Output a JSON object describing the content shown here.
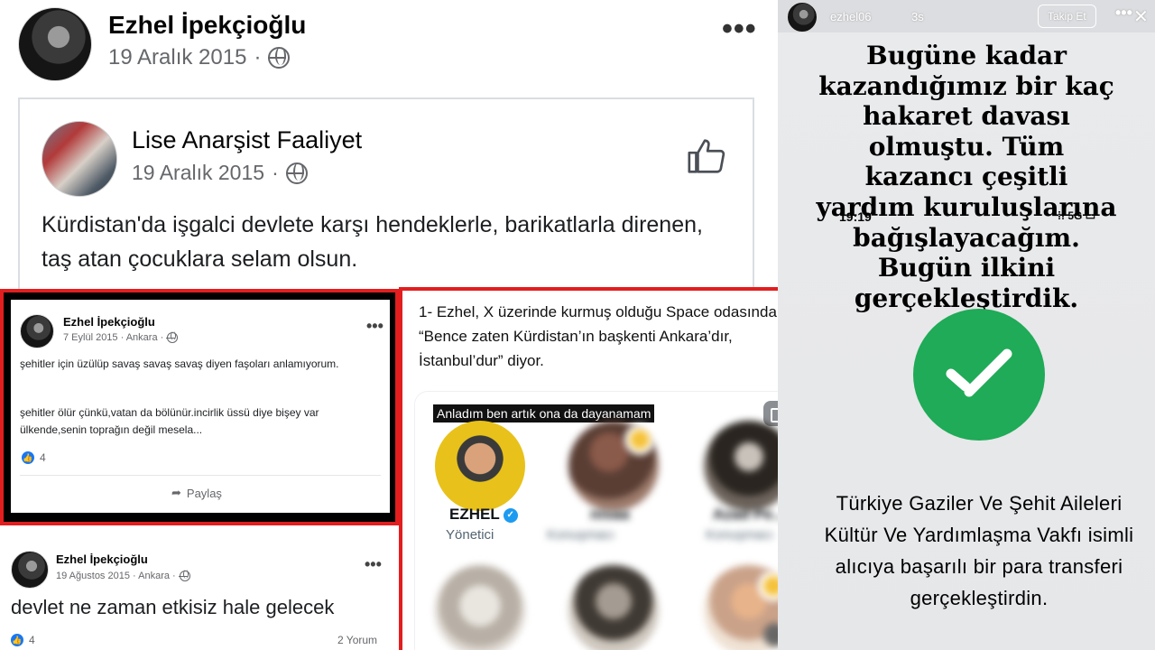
{
  "fb_post": {
    "author": "Ezhel İpekçioğlu",
    "date": "19 Aralık 2015",
    "separator": "·",
    "more": "•••",
    "shared": {
      "author": "Lise Anarşist Faaliyet",
      "date": "19 Aralık 2015",
      "separator": "·",
      "text": "Kürdistan'da işgalci devlete karşı hendeklerle, barikatlarla direnen, taş atan çocuklara selam olsun."
    }
  },
  "fb_post_2": {
    "author": "Ezhel İpekçioğlu",
    "date": "7 Eylül 2015 · Ankara ·",
    "more": "•••",
    "line1": "şehitler için üzülüp savaş savaş savaş diyen faşoları anlamıyorum.",
    "line2": "şehitler ölür çünkü,vatan da bölünür.incirlik üssü diye bişey var ülkende,senin toprağın değil mesela...",
    "reactions": "4",
    "share_label": "Paylaş"
  },
  "fb_post_3": {
    "author": "Ezhel İpekçioğlu",
    "date": "19 Ağustos 2015 · Ankara ·",
    "more": "•••",
    "text": "devlet ne zaman etkisiz hale gelecek",
    "reactions": "4",
    "comments": "2 Yorum"
  },
  "space": {
    "caption": "1- Ezhel, X üzerinde kurmuş olduğu Space odasında “Bence zaten Kürdistan’ın başkenti Ankara’dır, İstanbul’dur” diyor.",
    "banner": "Anladım ben artık ona da dayanamam",
    "participants": [
      {
        "name": "EZHEL",
        "role": "Yönetici"
      },
      {
        "name": "nisaa",
        "role": "Konuşmacı"
      },
      {
        "name": "Azad Pe...",
        "role": "Konuşmacı"
      }
    ]
  },
  "story": {
    "username": "ezhel06",
    "time": "3s",
    "follow": "Takip Et",
    "more": "•••",
    "close": "✕",
    "headline": "Bugüne kadar kazandığımız bir kaç hakaret davası olmuştu. Tüm kazancı çeşitli yardım kuruluşlarına bağışlayacağım. Bugün ilkini gerçekleştirdik.",
    "clock": "19:19",
    "status": "5G",
    "body": "Türkiye Gaziler Ve Şehit Aileleri Kültür Ve Yardımlaşma Vakfı isimli alıcıya başarılı bir para transferi gerçekleştirdin.",
    "check_color": "#1fab57"
  }
}
